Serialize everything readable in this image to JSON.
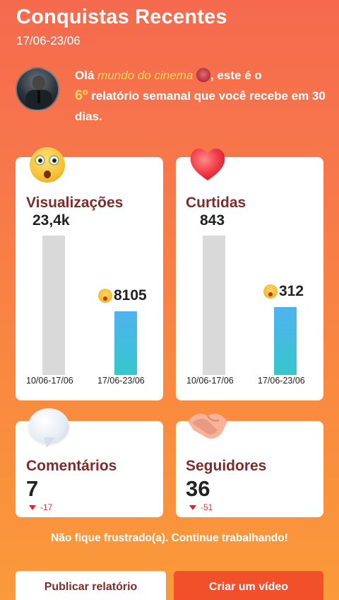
{
  "header": {
    "title": "Conquistas Recentes",
    "date_range": "17/06-23/06"
  },
  "greeting": {
    "prefix": "Olá",
    "username": "mundo do cinema",
    "middle": ", este é o",
    "ordinal": "6º",
    "suffix": "relatório semanal que você recebe em 30 dias."
  },
  "cards": {
    "views": {
      "title": "Visualizações",
      "prev_value": "23,4k",
      "current_value": "8105",
      "prev_label": "10/06-17/06",
      "current_label": "17/06-23/06",
      "prev_numeric": 23400,
      "current_numeric": 8105
    },
    "likes": {
      "title": "Curtidas",
      "prev_value": "843",
      "current_value": "312",
      "prev_label": "10/06-17/06",
      "current_label": "17/06-23/06",
      "prev_numeric": 843,
      "current_numeric": 312
    },
    "comments": {
      "title": "Comentários",
      "value": "7",
      "delta": "-17"
    },
    "followers": {
      "title": "Seguidores",
      "value": "36",
      "delta": "-51"
    }
  },
  "motivation": "Não fique frustrado(a). Continue trabalhando!",
  "buttons": {
    "publish": "Publicar relatório",
    "create": "Criar um vídeo"
  },
  "colors": {
    "accent": "#f2502a",
    "highlight": "#ffd75a",
    "title_brown": "#7a2d2a",
    "bar_grey": "#d9d9d9",
    "bar_blue": "#36c7cc",
    "decrease_red": "#d8262a"
  }
}
